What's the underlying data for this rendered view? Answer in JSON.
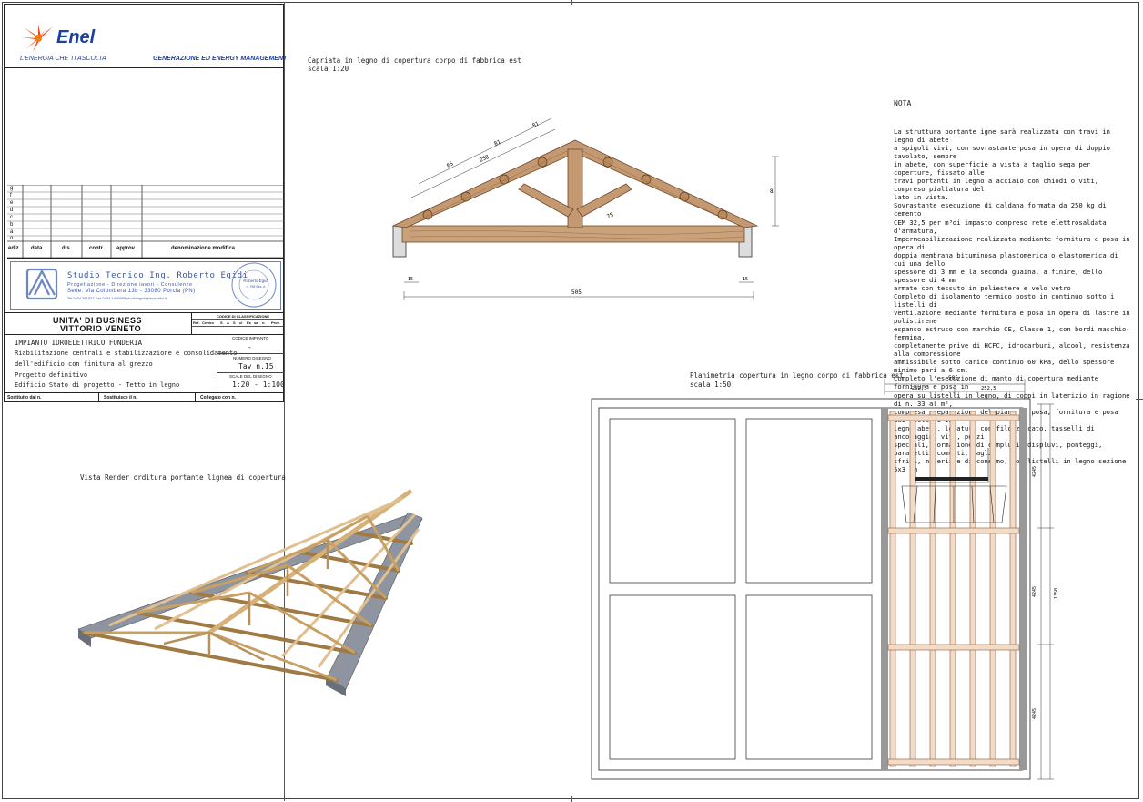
{
  "company": {
    "logo_text": "Enel",
    "tagline": "L'ENERGIA CHE TI ASCOLTA",
    "division": "GENERAZIONE ED ENERGY MANAGEMENT"
  },
  "revision_rows": [
    "g",
    "f",
    "e",
    "d",
    "c",
    "b",
    "a",
    "o"
  ],
  "revision_headers": {
    "ediz": "ediz.",
    "data": "data",
    "dis": "dis.",
    "contr": "contr.",
    "approv": "approv.",
    "denominazione": "denominazione modifica"
  },
  "studio": {
    "name": "Studio Tecnico Ing. Roberto Egidi",
    "services": "Progettazione - Direzione lavori - Consulenze",
    "address": "Sede: Via Colombera 13b - 33080 Porcia (PN)",
    "contacts": "Tel.0434 361827 Fax 0434 1440995 studio.egidi@tecnoaltri.it",
    "stamp_name": "Roberto Egidi",
    "stamp_number": "n. 798 Sez. A"
  },
  "unit": {
    "line1": "UNITA' DI BUSINESS",
    "line2": "VITTORIO VENETO",
    "classification_label": "CODICE DI CLASSIFICAZIONE",
    "classification_cols": [
      "Ref.",
      "Centro",
      "S",
      "A",
      "S",
      "cl",
      "Es",
      "sa",
      "n.",
      "Prov."
    ]
  },
  "project": {
    "plant": "IMPIANTO IDROELETTRICO FONDERIA",
    "desc1": "Riabilitazione centrali e stabilizzazione e consolidamento",
    "desc2": "dell'edificio con finitura al grezzo",
    "phase": "Progetto definitivo",
    "subject": "Edificio Stato di progetto - Tetto in legno",
    "code_label": "CODICE IMPIANTO",
    "code_value": "-",
    "drawing_label": "NUMERO DISEGNO",
    "drawing_value": "Tav n.15",
    "scale_label": "SCALE DEL DISEGNO",
    "scale_value": "1:20 - 1:100"
  },
  "footer": {
    "sostituito": "Sostituito dal n.",
    "sostituisce": "Sostituisce il n.",
    "collegato": "Collegato con n."
  },
  "truss": {
    "title": "Capriata in legno di copertura corpo di fabbrica est",
    "scale": "scala 1:20",
    "dim_span": "505",
    "dim_left": "15",
    "dim_right": "15",
    "dim_height": "8",
    "dim_a": "65",
    "dim_b": "81",
    "dim_c": "81",
    "dim_d": "258",
    "dim_e": "75"
  },
  "nota": {
    "heading": "NOTA",
    "lines": [
      "La struttura portante igne sarà realizzata con travi in legno di abete",
      "a spigoli vivi, con sovrastante posa in opera di doppio tavolato, sempre",
      "in abete, con superficie a vista a taglio sega per coperture, fissato alle",
      "travi portanti in legno a acciaio con chiodi o viti, compreso piallatura del",
      "lato in vista.",
      "Sovrastante esecuzione di caldana formata da 250 kg di cemento",
      "CEM   32,5 per m³di impasto compreso rete elettrosaldata d'armatura,",
      "Impermeabilizzazione realizzata mediante fornitura e posa in opera di",
      "doppia membrana bituminosa plastomerica o elastomerica di cui una dello",
      "spessore di 3 mm e la seconda guaina, a finire, dello spessore  di 4 mm",
      "armate con tessuto in poliestere e velo vetro",
      "Completo di isolamento termico posto in continuo sotto i listelli di",
      "ventilazione mediante fornitura e posa in opera di lastre in polistirene",
      "espanso estruso con marchio CE, Classe 1, con bordi maschio-femmina,",
      "completamente prive di HCFC, idrocarburi, alcool, resistenza alla compressione",
      "ammissibile sotto carico continuo 60 kPa, dello spessore minimo pari a 6 cm.",
      "Completo l'esecuzione di manto di copertura mediante fornitura e posa in",
      "opera su listelli in legno, di coppi in laterizio in ragione di n. 33 al m²,",
      "compresa preparazione del piano di posa, fornitura e posa dei listelli in",
      "legno abete, legature con filo zincato, tasselli di ancoraggio, viti, pezzi",
      "speciali, formazione di compluvi, displuvi, ponteggi, parasetti, comunti, tagli,",
      "sfridi, materiale di consumo, con listelli in legno sezione 5x3 cm"
    ]
  },
  "plan": {
    "title": "Planimetria copertura in legno corpo di fabbrica est",
    "scale": "scala 1:50",
    "dim_total": "505",
    "dim_half_left": "252,5",
    "dim_half_right": "252,5",
    "dim_side_a": "4245",
    "dim_side_b": "4245",
    "dim_side_c": "4245",
    "dim_side_total": "1350"
  },
  "render": {
    "title": "Vista Render orditura portante lignea di copertura"
  }
}
